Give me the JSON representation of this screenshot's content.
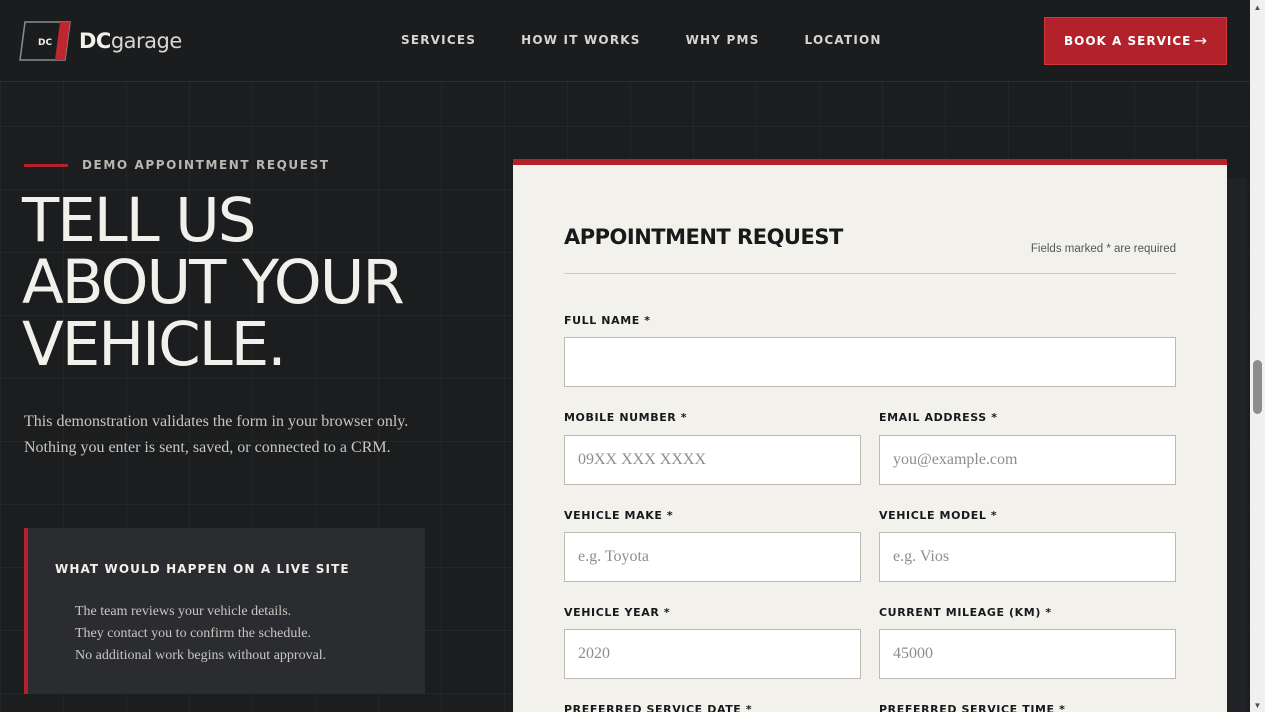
{
  "header": {
    "logo_badge": "DC",
    "logo_bold": "DC",
    "logo_light": "garage",
    "nav": [
      "SERVICES",
      "HOW IT WORKS",
      "WHY PMS",
      "LOCATION"
    ],
    "cta_label": "BOOK A SERVICE",
    "cta_arrow": "→"
  },
  "hero": {
    "eyebrow": "DEMO APPOINTMENT REQUEST",
    "title_lines": [
      "TELL US",
      "ABOUT YOUR",
      "VEHICLE."
    ],
    "description": "This demonstration validates the form in your browser only. Nothing you enter is sent, saved, or connected to a CRM.",
    "live_box": {
      "title": "WHAT WOULD HAPPEN ON A LIVE SITE",
      "items": [
        "The team reviews your vehicle details.",
        "They contact you to confirm the schedule.",
        "No additional work begins without approval."
      ]
    }
  },
  "form": {
    "title": "APPOINTMENT REQUEST",
    "required_note": "Fields marked * are required",
    "fields": {
      "full_name": {
        "label": "FULL NAME *",
        "placeholder": "",
        "value": ""
      },
      "mobile": {
        "label": "MOBILE NUMBER *",
        "placeholder": "09XX XXX XXXX",
        "value": ""
      },
      "email": {
        "label": "EMAIL ADDRESS *",
        "placeholder": "you@example.com",
        "value": ""
      },
      "make": {
        "label": "VEHICLE MAKE *",
        "placeholder": "e.g. Toyota",
        "value": ""
      },
      "model": {
        "label": "VEHICLE MODEL *",
        "placeholder": "e.g. Vios",
        "value": ""
      },
      "year": {
        "label": "VEHICLE YEAR *",
        "placeholder": "2020",
        "value": ""
      },
      "mileage": {
        "label": "CURRENT MILEAGE (KM) *",
        "placeholder": "45000",
        "value": ""
      },
      "service_date": {
        "label": "PREFERRED SERVICE DATE *"
      },
      "service_time": {
        "label": "PREFERRED SERVICE TIME *"
      }
    }
  },
  "colors": {
    "accent": "#b3222a",
    "background": "#1b1d1f",
    "card": "#f3f1ec"
  }
}
